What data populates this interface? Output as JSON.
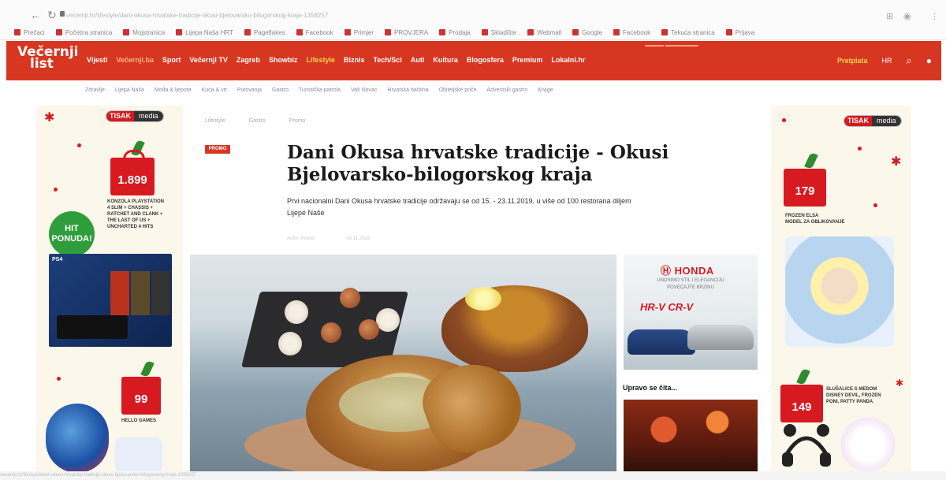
{
  "browser": {
    "url": "vecernji.hr/lifestyle/dani-okusa-hrvatske-tradicije-okusi-bjelovarsko-bilogorskog-kraja-1358257",
    "bookmarks": [
      "Prečaci",
      "Početna stranica",
      "Mojstranica",
      "Lijepa Naša HRT",
      "Pageflakes",
      "Facebook",
      "Primjer",
      "PROVJERA",
      "Prodaja",
      "Skladište",
      "Webmail",
      "Google",
      "Facebook",
      "Tekuća stranica",
      "Prijava"
    ]
  },
  "site": {
    "logo_line1": "Večernji",
    "logo_line2": "list",
    "nav": [
      "Vijesti",
      "Večernji.ba",
      "Sport",
      "Večernji TV",
      "Zagreb",
      "Showbiz",
      "Lifestyle",
      "Biznis",
      "Tech/Sci",
      "Auti",
      "Kultura",
      "Blogosfera",
      "Premium",
      "Lokalni.hr"
    ],
    "active_nav": "Lifestyle",
    "highlight_nav": "Večernji.ba",
    "header_right": {
      "subscribe": "Pretplata",
      "user": "Prijava",
      "lang": "HR"
    },
    "subnav": [
      "Zdravlje",
      "Lijepa Naša",
      "Moda & ljepota",
      "Kuća & vrt",
      "Putovanja",
      "Gastro",
      "Turistička patrola",
      "Vaš Novac",
      "Hrvatska baština",
      "Obiteljske priče",
      "Adventski gastro",
      "Knjige"
    ],
    "accent": "#d73721"
  },
  "ads": {
    "brand1": "TISAK",
    "brand2": "media",
    "left_price1": "1.899",
    "left_price1_cents": "00",
    "left_desc1": "KONZOLA PLAYSTATION\n4 SLIM + CHASSIS +\nRATCHET AND CLANK +\nTHE LAST OF US +\nUNCHARTED 4 HITS",
    "hit_badge": "HIT\nPONUDA!",
    "ps4_label": "PS4",
    "left_price2": "99",
    "left_price2_cents": "99",
    "left_desc2": "HELLO GAMES",
    "right_price1": "179",
    "right_price1_cents": "99",
    "right_desc1": "FROZEN ELSA\nMODEL ZA OBLIKOVANJE",
    "right_price2": "149",
    "right_price2_cents": "99",
    "right_desc2": "SLUŠALICE S MEDOM\nDISNEY DEVIL, FROZEN\nPONI, PATTY PANDA"
  },
  "article": {
    "breadcrumb": [
      "Lifestyle",
      "Gastro",
      "Promo"
    ],
    "tag": "PROMO",
    "title": "Dani Okusa hrvatske tradicije - Okusi Bjelovarsko-bilogorskog kraja",
    "lead": "Prvi nacionalni Dani Okusa hrvatske tradicije održavaju se od 15. - 23.11.2019. u više od 100 restorana diljem Lijepe Naše",
    "meta_author": "Autor: Promo",
    "meta_date": "14.11.2019."
  },
  "honda_ad": {
    "logo": "HONDA",
    "tagline": "UNOSIMO STIL I ELEGANCIJU\nPOVEĆAJTE BRZINU",
    "models": "HR-V   CR-V"
  },
  "sidebar": {
    "reading_heading": "Upravo se čita..."
  }
}
